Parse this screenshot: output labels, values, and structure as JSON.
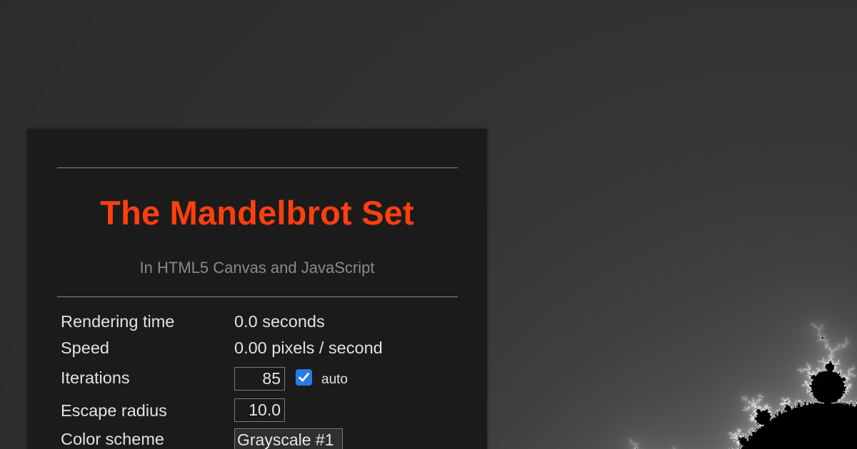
{
  "panel": {
    "title": "The Mandelbrot Set",
    "subtitle": "In HTML5 Canvas and JavaScript",
    "stats": {
      "rendering_time_label": "Rendering time",
      "rendering_time_value": "0.0 seconds",
      "speed_label": "Speed",
      "speed_value": "0.00 pixels / second"
    },
    "controls": {
      "iterations_label": "Iterations",
      "iterations_value": "85",
      "auto_checked": true,
      "auto_label": "auto",
      "escape_radius_label": "Escape radius",
      "escape_radius_value": "10.0",
      "color_scheme_label": "Color scheme",
      "color_scheme_value": "Grayscale #1"
    }
  },
  "colors": {
    "background": "#0e0e0e",
    "panel_background": "#1b1b1b",
    "title": "#ff3f0f",
    "subtitle": "#8a8a8a",
    "text": "#e2e2e2",
    "checkbox_accent": "#2a7be4"
  },
  "icons": {
    "checkbox_mark": "checkmark-icon"
  }
}
